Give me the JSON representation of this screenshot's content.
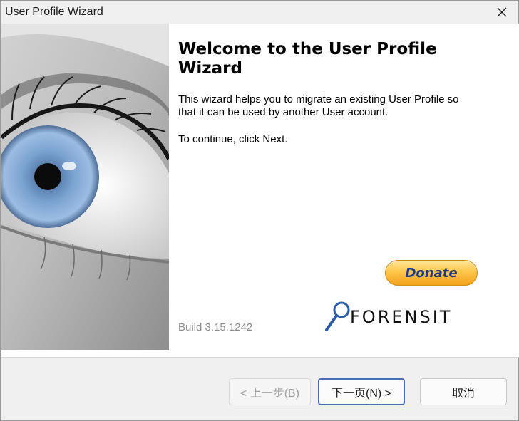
{
  "window": {
    "title": "User Profile Wizard",
    "close_icon": "close-icon"
  },
  "main": {
    "heading": "Welcome to the User Profile Wizard",
    "description": "This wizard helps you to migrate an existing User Profile so that it can be used by another User account.",
    "instruction": "To continue, click Next.",
    "donate_label": "Donate",
    "build": "Build 3.15.1242",
    "logo_text": "FORENSIT",
    "side_image": "eye-photo"
  },
  "buttons": {
    "back": "< 上一步(B)",
    "next": "下一页(N) >",
    "cancel": "取消"
  },
  "colors": {
    "donate_text": "#1a3b8c",
    "donate_gold": "#ffc64a",
    "logo_accent": "#2a5caa",
    "default_button_border": "#4a6fb0"
  }
}
